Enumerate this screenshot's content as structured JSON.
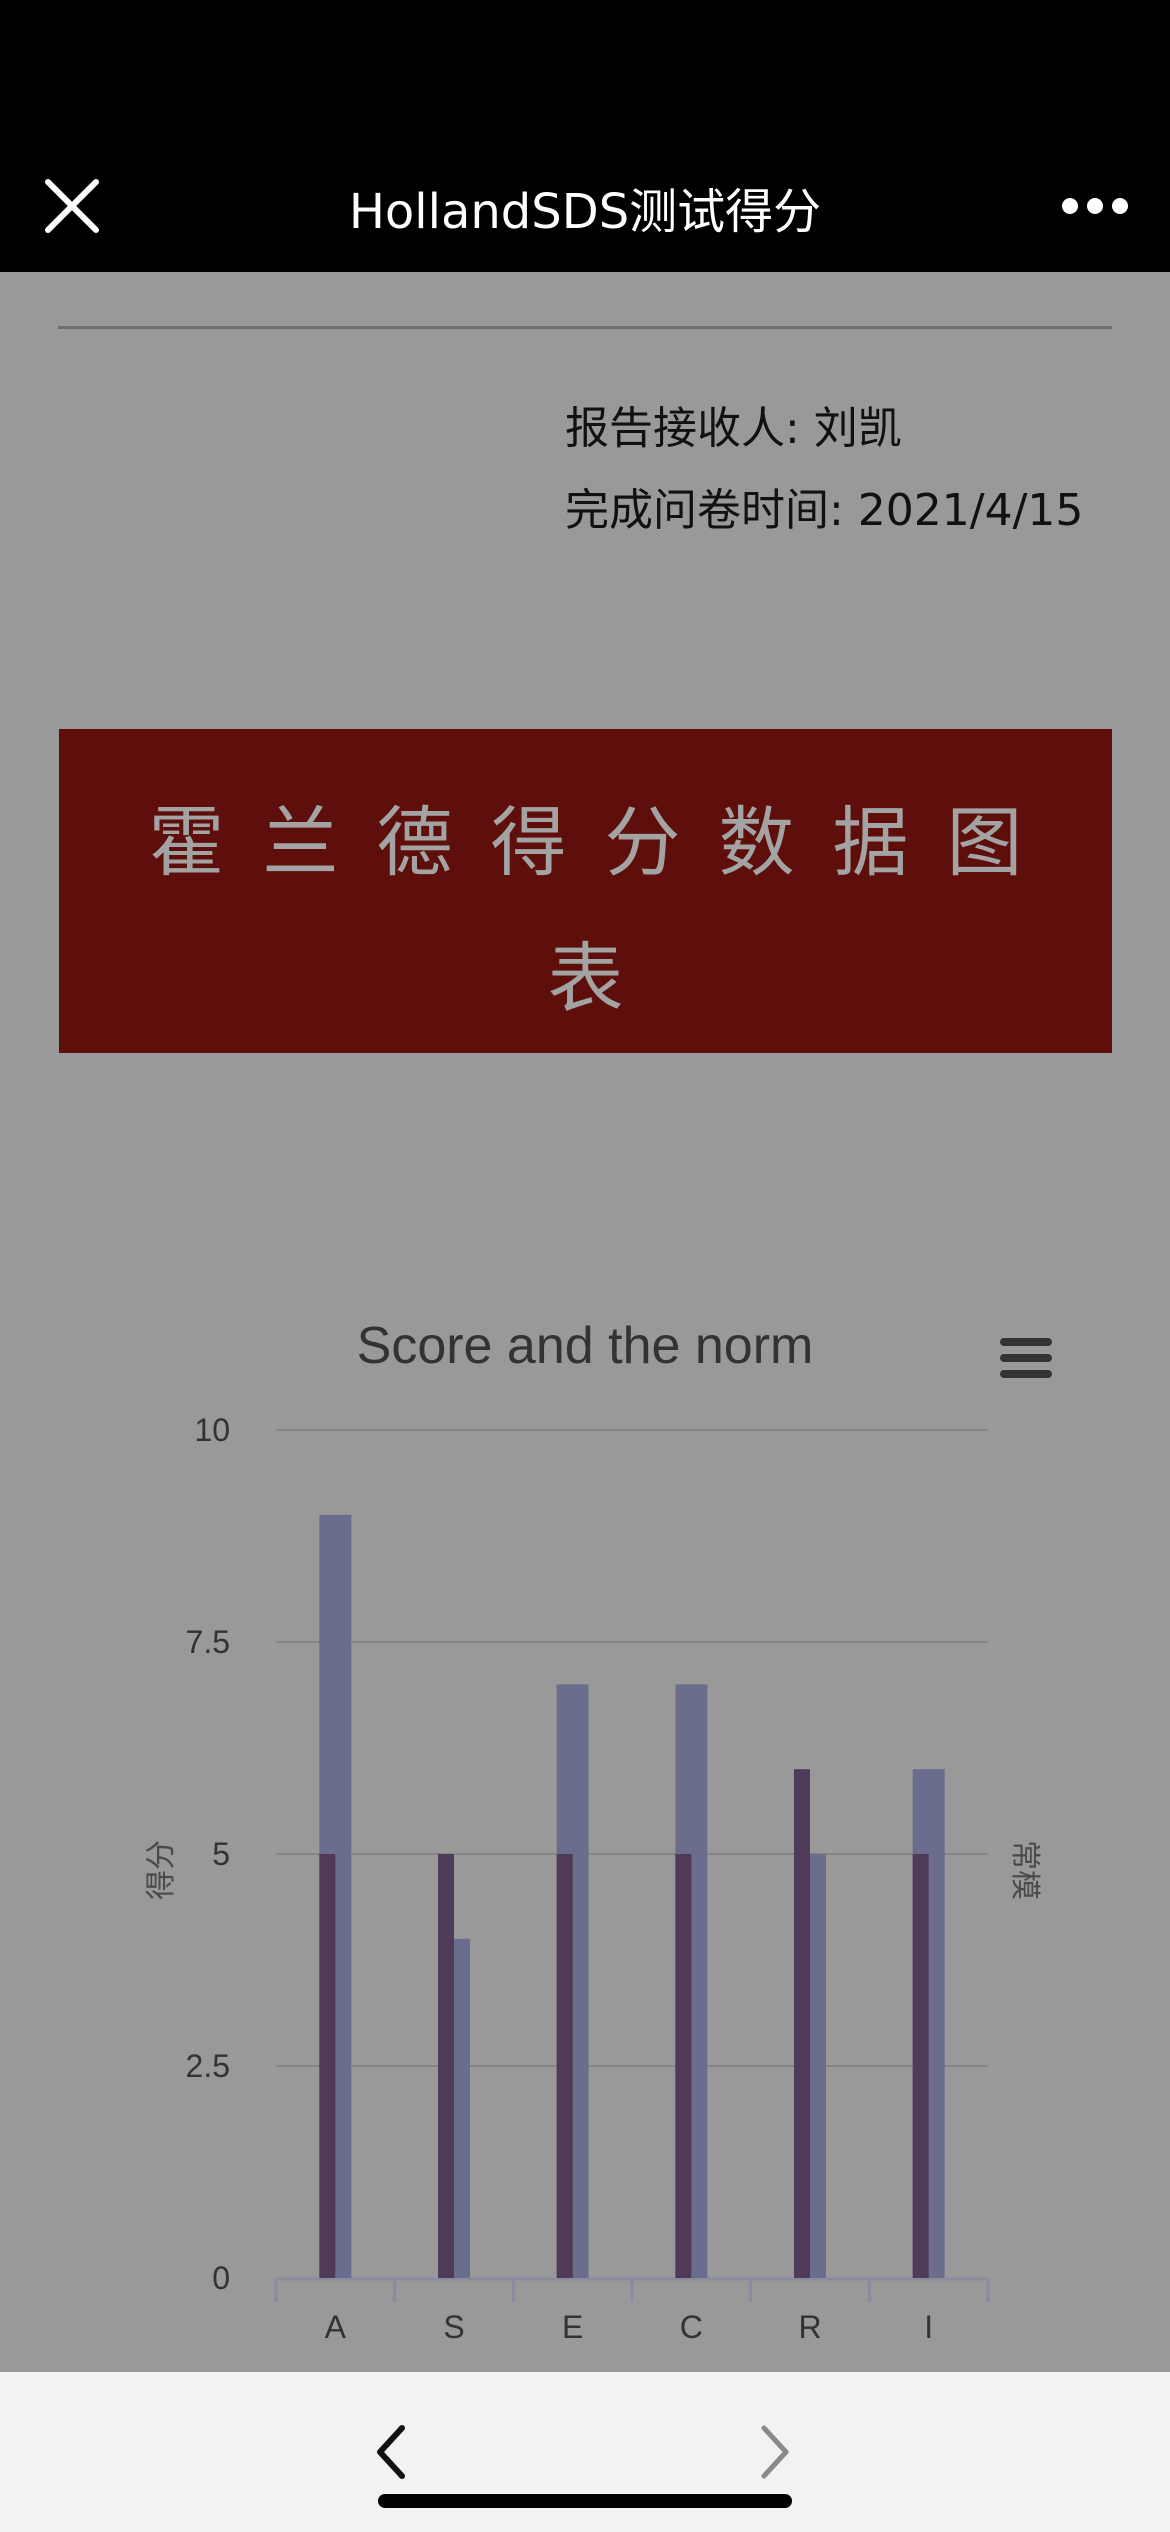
{
  "header": {
    "title": "HollandSDS测试得分"
  },
  "report": {
    "recipient": "报告接收人: 刘凯",
    "completed": "完成问卷时间: 2021/4/15"
  },
  "banner": {
    "line1": "霍兰德得分数据图",
    "line2": "表"
  },
  "chart_data": {
    "type": "bar",
    "title": "Score and the norm",
    "ylabel_left": "得分",
    "ylabel_right": "常模",
    "categories": [
      "A",
      "S",
      "E",
      "C",
      "R",
      "I"
    ],
    "yticks": [
      "0",
      "2.5",
      "5",
      "7.5",
      "10"
    ],
    "ylim": [
      0,
      10
    ],
    "series": [
      {
        "values": [
          9,
          4,
          7,
          7,
          5,
          6
        ],
        "color": "#6a6e8c"
      },
      {
        "values": [
          5,
          5,
          5,
          5,
          6,
          5
        ],
        "color": "#4f3a58"
      }
    ],
    "grid": true
  },
  "colors": {
    "topbar": "#000000",
    "background": "#999999",
    "banner": "#5f0f0b",
    "bottombar": "#f2f2f2"
  },
  "icons": {
    "close": "close-icon",
    "more": "more-icon",
    "menu": "menu-icon",
    "back": "chevron-left-icon",
    "forward": "chevron-right-icon"
  }
}
